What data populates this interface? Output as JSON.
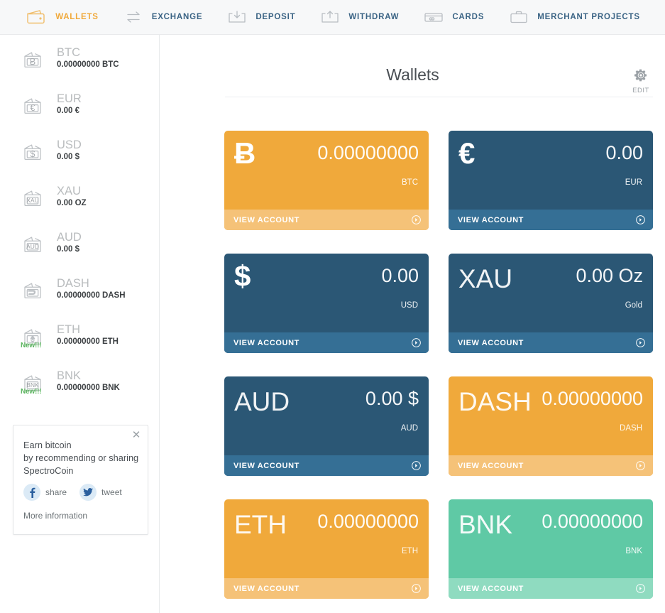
{
  "nav": {
    "items": [
      {
        "label": "WALLETS",
        "icon": "wallet-icon",
        "active": true
      },
      {
        "label": "EXCHANGE",
        "icon": "exchange-arrows-icon",
        "active": false
      },
      {
        "label": "DEPOSIT",
        "icon": "deposit-down-arrow-icon",
        "active": false
      },
      {
        "label": "WITHDRAW",
        "icon": "withdraw-up-arrow-icon",
        "active": false
      },
      {
        "label": "CARDS",
        "icon": "credit-card-icon",
        "active": false
      },
      {
        "label": "MERCHANT PROJECTS",
        "icon": "briefcase-icon",
        "active": false
      }
    ],
    "active_color": "#f0a93b",
    "inactive_color": "#3b6485"
  },
  "sidebar": {
    "wallets": [
      {
        "code": "BTC",
        "balance": "0.00000000 BTC",
        "icon": "wallet-btc-icon",
        "symbol": "Ƀ",
        "badge": ""
      },
      {
        "code": "EUR",
        "balance": "0.00 €",
        "icon": "wallet-eur-icon",
        "symbol": "€",
        "badge": ""
      },
      {
        "code": "USD",
        "balance": "0.00 $",
        "icon": "wallet-usd-icon",
        "symbol": "$",
        "badge": ""
      },
      {
        "code": "XAU",
        "balance": "0.00 OZ",
        "icon": "wallet-xau-icon",
        "symbol": "XAU",
        "badge": ""
      },
      {
        "code": "AUD",
        "balance": "0.00 $",
        "icon": "wallet-aud-icon",
        "symbol": "AUD",
        "badge": ""
      },
      {
        "code": "DASH",
        "balance": "0.00000000 DASH",
        "icon": "wallet-dash-icon",
        "symbol": "D",
        "badge": ""
      },
      {
        "code": "ETH",
        "balance": "0.00000000 ETH",
        "icon": "wallet-eth-icon",
        "symbol": "♦",
        "badge": "New!!!"
      },
      {
        "code": "BNK",
        "balance": "0.00000000 BNK",
        "icon": "wallet-bnk-icon",
        "symbol": "BNK",
        "badge": "New!!!"
      }
    ],
    "badge_color": "#5ab45e"
  },
  "promo": {
    "close_icon": "close-icon",
    "line1": "Earn bitcoin",
    "line2": "by recommending or sharing",
    "line3": "SpectroCoin",
    "share_label": "share",
    "tweet_label": "tweet",
    "more_label": "More information"
  },
  "header": {
    "title": "Wallets",
    "edit_label": "EDIT",
    "edit_icon": "gear-icon"
  },
  "cards": [
    {
      "symbol": "Ƀ",
      "symbol_style": "bold",
      "amount": "0.00000000",
      "sub": "BTC",
      "foot": "VIEW ACCOUNT",
      "theme": "c-orange",
      "color": "#f0a93b",
      "name": "btc"
    },
    {
      "symbol": "€",
      "symbol_style": "bold",
      "amount": "0.00",
      "sub": "EUR",
      "foot": "VIEW ACCOUNT",
      "theme": "c-blue",
      "color": "#2b5775",
      "name": "eur"
    },
    {
      "symbol": "$",
      "symbol_style": "bold",
      "amount": "0.00",
      "sub": "USD",
      "foot": "VIEW ACCOUNT",
      "theme": "c-blue",
      "color": "#2b5775",
      "name": "usd"
    },
    {
      "symbol": "XAU",
      "symbol_style": "thin",
      "amount": "0.00 Oz",
      "sub": "Gold",
      "foot": "VIEW ACCOUNT",
      "theme": "c-blue",
      "color": "#2b5775",
      "name": "xau"
    },
    {
      "symbol": "AUD",
      "symbol_style": "thin",
      "amount": "0.00 $",
      "sub": "AUD",
      "foot": "VIEW ACCOUNT",
      "theme": "c-blue",
      "color": "#2b5775",
      "name": "aud"
    },
    {
      "symbol": "DASH",
      "symbol_style": "thin",
      "amount": "0.00000000",
      "sub": "DASH",
      "foot": "VIEW ACCOUNT",
      "theme": "c-orange",
      "color": "#f0a93b",
      "name": "dash"
    },
    {
      "symbol": "ETH",
      "symbol_style": "thin",
      "amount": "0.00000000",
      "sub": "ETH",
      "foot": "VIEW ACCOUNT",
      "theme": "c-orange",
      "color": "#f0a93b",
      "name": "eth"
    },
    {
      "symbol": "BNK",
      "symbol_style": "thin",
      "amount": "0.00000000",
      "sub": "BNK",
      "foot": "VIEW ACCOUNT",
      "theme": "c-green",
      "color": "#5fc9a5",
      "name": "bnk"
    }
  ]
}
